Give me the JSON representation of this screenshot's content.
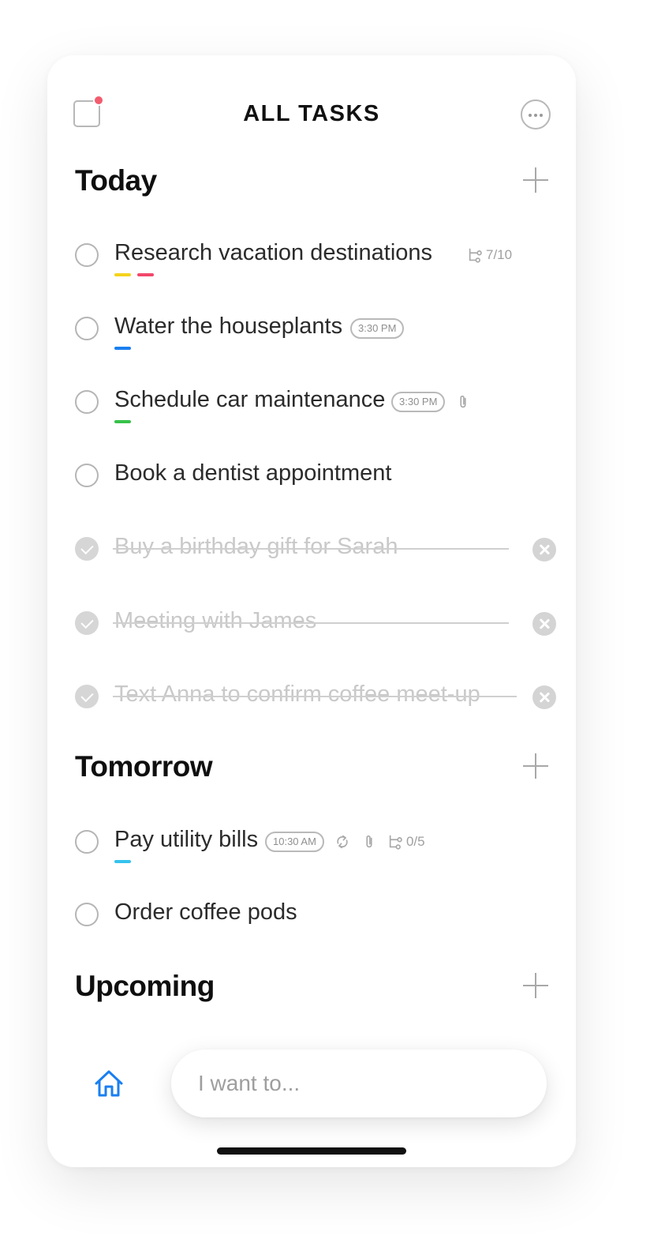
{
  "header": {
    "title": "ALL TASKS"
  },
  "colors": {
    "notification_dot": "#f25c6e",
    "tag_yellow": "#f5d31b",
    "tag_red": "#f2476a",
    "tag_blue": "#1a7ff0",
    "tag_green": "#36c24a",
    "tag_cyan": "#36c3ee",
    "home_icon": "#1a7ff0"
  },
  "sections": {
    "today": {
      "title": "Today",
      "tasks": [
        {
          "title": "Research vacation destinations",
          "subtasks": "7/10",
          "tags": [
            "yellow",
            "red"
          ]
        },
        {
          "title": "Water the houseplants",
          "time": "3:30 PM",
          "tags": [
            "blue"
          ]
        },
        {
          "title": "Schedule car maintenance",
          "time": "3:30 PM",
          "attachment": true,
          "tags": [
            "green"
          ]
        },
        {
          "title": "Book a dentist appointment"
        },
        {
          "title": "Buy a birthday gift for Sarah",
          "completed": true
        },
        {
          "title": "Meeting with James",
          "completed": true
        },
        {
          "title": "Text Anna to confirm coffee meet-up",
          "completed": true
        }
      ]
    },
    "tomorrow": {
      "title": "Tomorrow",
      "tasks": [
        {
          "title": "Pay utility bills",
          "time": "10:30 AM",
          "repeat": true,
          "attachment": true,
          "subtasks": "0/5",
          "tags": [
            "cyan"
          ]
        },
        {
          "title": "Order coffee pods"
        }
      ]
    },
    "upcoming": {
      "title": "Upcoming"
    }
  },
  "bottom_bar": {
    "input_placeholder": "I want to...",
    "home_icon": "home-icon"
  }
}
